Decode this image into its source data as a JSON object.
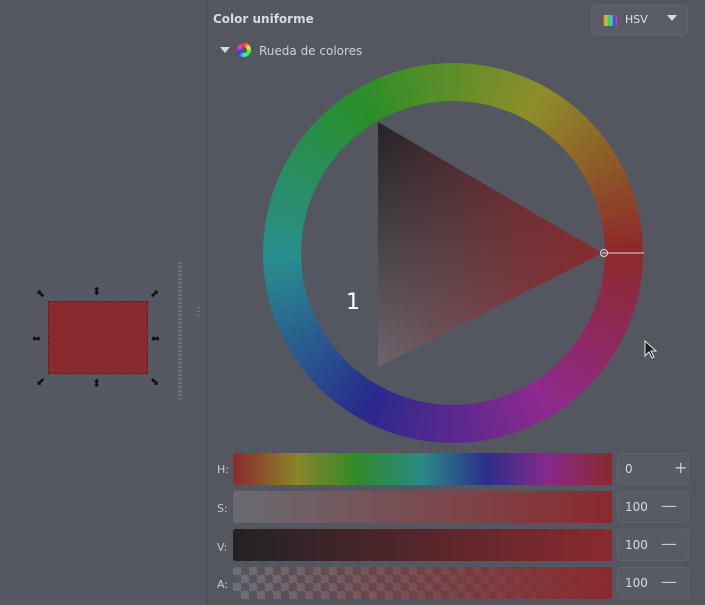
{
  "panel": {
    "title": "Color uniforme",
    "mode_select": {
      "label": "HSV",
      "icon": "hsv-icon"
    },
    "section": {
      "label": "Rueda de colores",
      "icon": "color-wheel-icon"
    },
    "overlay_label": "1"
  },
  "selected_color": "#8a2a2e",
  "sliders": [
    {
      "label": "H:",
      "value": "0",
      "button": "+"
    },
    {
      "label": "S:",
      "value": "100",
      "button": "—"
    },
    {
      "label": "V:",
      "value": "100",
      "button": "—"
    },
    {
      "label": "A:",
      "value": "100",
      "button": "—"
    }
  ],
  "icons": {
    "handle_arrows": "resize-handle-icon",
    "cursor": "mouse-pointer-icon",
    "drag": "drag-handle-icon"
  }
}
